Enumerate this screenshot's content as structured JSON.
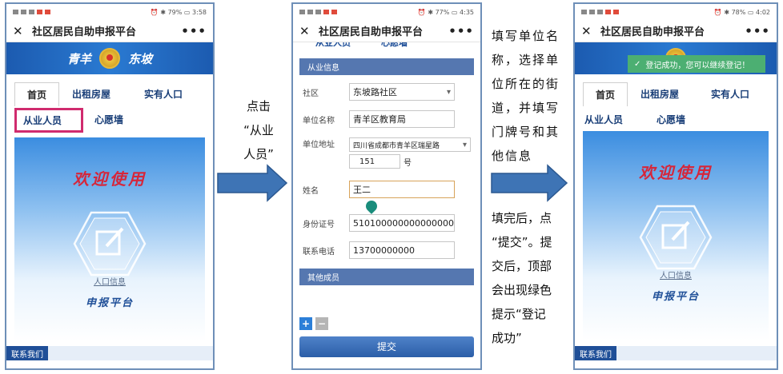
{
  "phone1": {
    "status_time": "3:58",
    "status_battery": "79%",
    "title": "社区居民自助申报平台",
    "banner_left": "青羊",
    "banner_right": "东坡",
    "tabs": [
      "首页",
      "出租房屋",
      "实有人口"
    ],
    "tabs2": [
      "从业人员",
      "心愿墙"
    ],
    "welcome": "欢迎使用",
    "icon_label": "人口信息",
    "sub_label": "申报平台",
    "footer": "联系我们"
  },
  "phone2": {
    "status_time": "4:35",
    "status_battery": "77%",
    "title": "社区居民自助申报平台",
    "cut_tabs": [
      "从业人员",
      "心愿墙"
    ],
    "section1": "从业信息",
    "fields": {
      "community_label": "社区",
      "community_value": "东坡路社区",
      "unit_label": "单位名称",
      "unit_value": "青羊区教育局",
      "address_label": "单位地址",
      "address_value": "四川省成都市青羊区瑞星路",
      "door_value": "151",
      "door_unit": "号",
      "name_label": "姓名",
      "name_value": "王二",
      "id_label": "身份证号",
      "id_value": "510100000000000000",
      "phone_label": "联系电话",
      "phone_value": "13700000000"
    },
    "section2": "其他成员",
    "plus": "+",
    "minus": "−",
    "submit": "提交"
  },
  "phone3": {
    "status_time": "4:02",
    "status_battery": "78%",
    "title": "社区居民自助申报平台",
    "toast": "登记成功，您可以继续登记！",
    "tabs": [
      "首页",
      "出租房屋",
      "实有人口"
    ],
    "tabs2": [
      "从业人员",
      "心愿墙"
    ],
    "welcome": "欢迎使用",
    "icon_label": "人口信息",
    "sub_label": "申报平台",
    "footer": "联系我们"
  },
  "annotations": {
    "step1": [
      "点击",
      "“从业",
      "人员”"
    ],
    "step2": [
      "填写单位名",
      "称，选择单",
      "位所在的街",
      "道，并填写",
      "门牌号和其",
      "他信息"
    ],
    "step3": [
      "填完后，点",
      "“提交”。提",
      "交后，顶部",
      "会出现绿色",
      "提示“登记",
      "成功”"
    ]
  }
}
